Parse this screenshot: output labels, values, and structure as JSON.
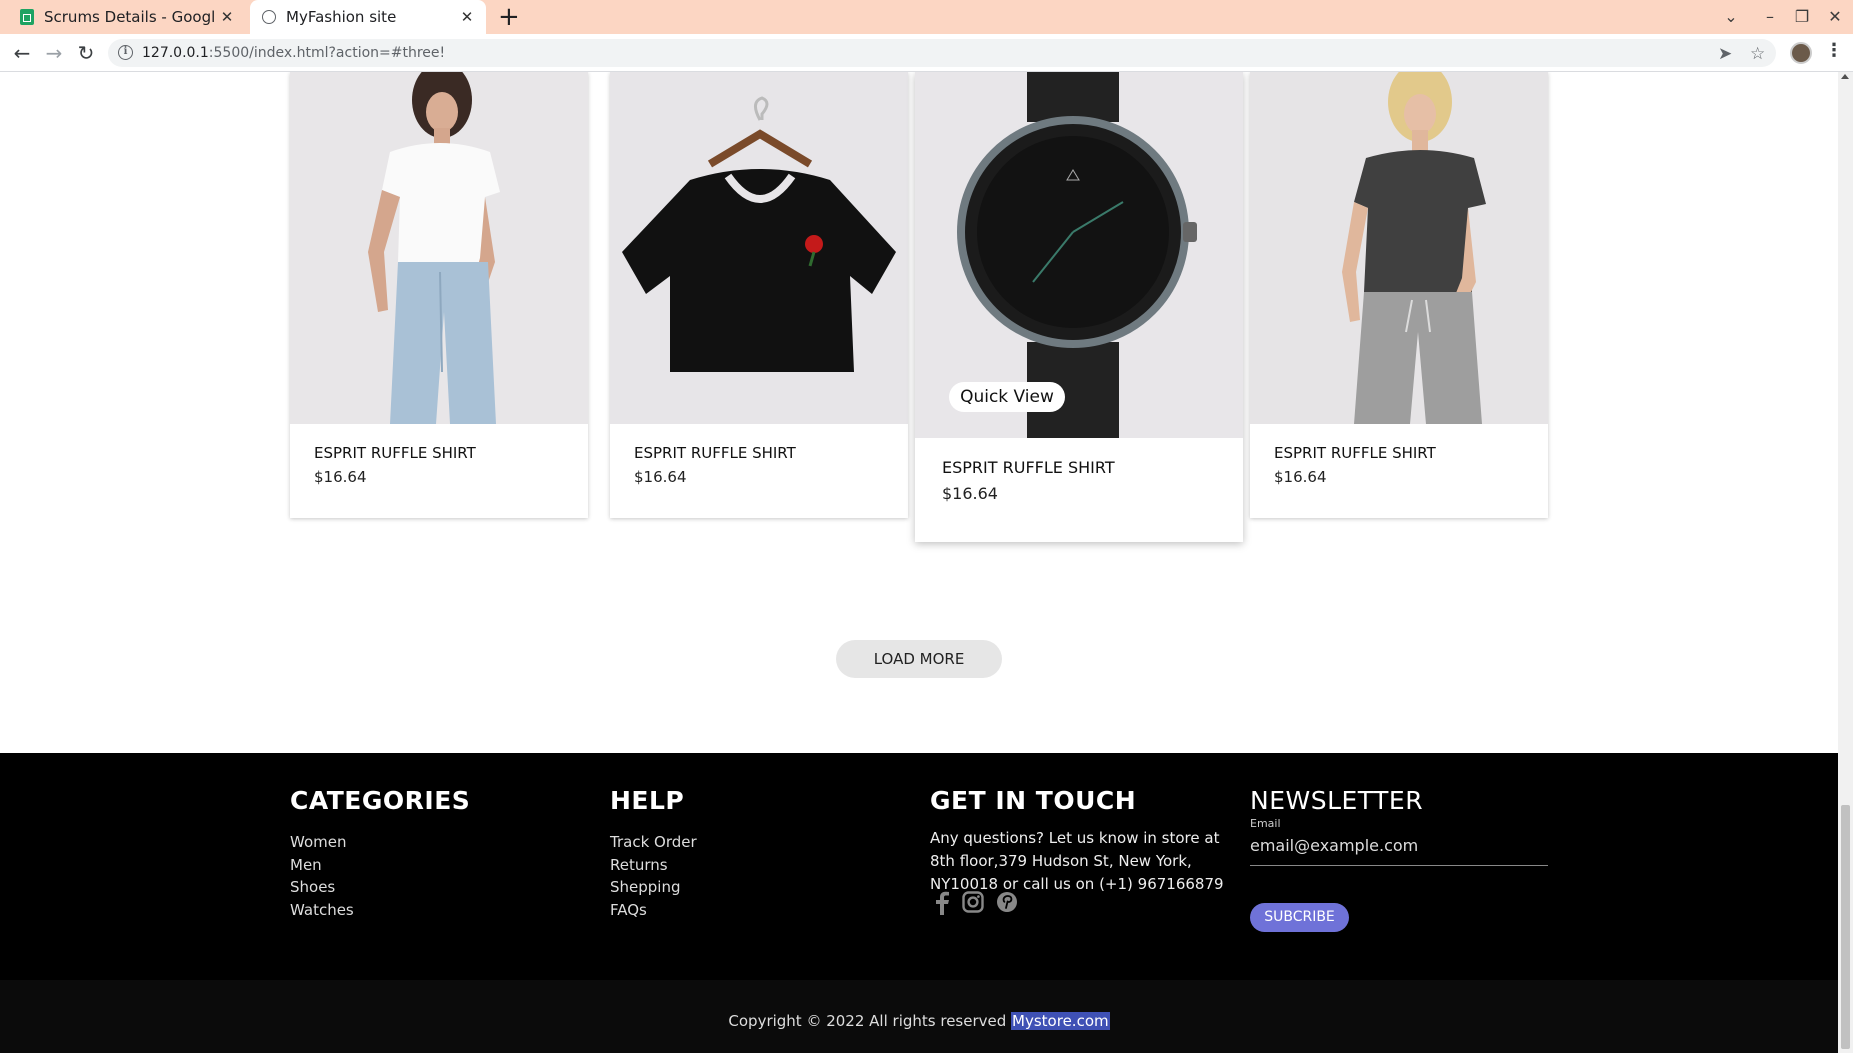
{
  "browser": {
    "tabs": [
      {
        "title": "Scrums Details - Google Sl",
        "icon": "sheets-icon",
        "active": false
      },
      {
        "title": "MyFashion site",
        "icon": "globe-icon",
        "active": true
      }
    ],
    "new_tab": "+",
    "url_host": "127.0.0.1",
    "url_rest": ":5500/index.html?action=#three!"
  },
  "products": [
    {
      "name": "ESPRIT RUFFLE SHIRT",
      "price": "$16.64",
      "image": "woman-white-tee-jeans"
    },
    {
      "name": "ESPRIT RUFFLE SHIRT",
      "price": "$16.64",
      "image": "black-tee-rose-hanger"
    },
    {
      "name": "ESPRIT RUFFLE SHIRT",
      "price": "$16.64",
      "image": "black-watch-mesh-strap",
      "hovered": true
    },
    {
      "name": "ESPRIT RUFFLE SHIRT",
      "price": "$16.64",
      "image": "woman-grey-tee-joggers"
    }
  ],
  "quick_view": "Quick View",
  "load_more": "LOAD MORE",
  "footer": {
    "categories": {
      "title": "CATEGORIES",
      "items": [
        "Women",
        "Men",
        "Shoes",
        "Watches"
      ]
    },
    "help": {
      "title": "HELP",
      "items": [
        "Track Order",
        "Returns",
        "Shepping",
        "FAQs"
      ]
    },
    "touch": {
      "title": "GET IN TOUCH",
      "text": "Any questions? Let us know in store at 8th floor,379 Hudson St, New York, NY10018 or call us on (+1) 967166879",
      "social": [
        "facebook-icon",
        "instagram-icon",
        "pinterest-icon"
      ]
    },
    "newsletter": {
      "title": "NEWSLETTER",
      "label": "Email",
      "placeholder": "email@example.com",
      "button": "SUBCRIBE"
    },
    "copyright": "Copyright © 2022 All rights reserved",
    "brand": "Mystore.com"
  },
  "colors": {
    "tabbar": "#fcd6c3",
    "accent": "#6f72d8",
    "footer": "#000000"
  }
}
